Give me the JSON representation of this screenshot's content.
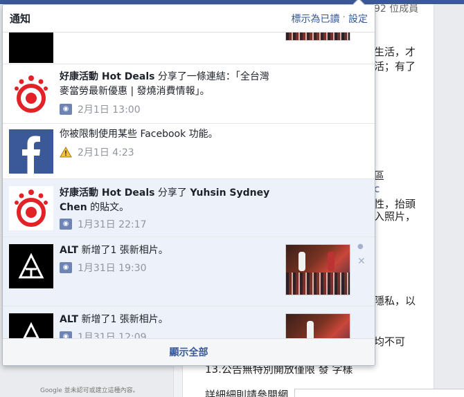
{
  "background": {
    "top_right_fragment": "92 位成員",
    "lines": [
      "生活，才",
      "活；有了",
      "區",
      "c",
      "性，抬頭",
      "入照片，",
      "隱私，以",
      "均不可",
      "13.公告無特別開放僅限 發 字樣",
      "詳細細則請參閱網"
    ],
    "left_footer": "Google 並未認可或建立這種內容。"
  },
  "panel": {
    "title": "通知",
    "mark_all_read": "標示為已讀",
    "separator": "·",
    "settings": "設定",
    "show_all": "顯示全部",
    "items": [
      {
        "actor": "好康活動 Hot Deals",
        "text": " 分享了一條連結：「全台灣麥當勞最新優惠 | 發燒消費情報」。",
        "time": "2月1日 13:00",
        "icon": "rss-icon",
        "unread": false
      },
      {
        "actor": "",
        "text": "你被限制使用某些 Facebook 功能。",
        "time": "2月1日 4:23",
        "icon": "warning-icon",
        "unread": false
      },
      {
        "actor": "好康活動 Hot Deals",
        "text": " 分享了 ",
        "target": "Yuhsin Sydney Chen",
        "text2": " 的貼文。",
        "time": "1月31日 22:17",
        "icon": "rss-icon",
        "unread": true
      },
      {
        "actor": "ALT",
        "text": " 新增了1 張新相片。",
        "time": "1月31日 19:30",
        "icon": "rss-icon",
        "unread": true
      },
      {
        "actor": "ALT",
        "text": " 新增了1 張新相片。",
        "time": "1月31日 12:09",
        "icon": "rss-icon",
        "unread": true
      }
    ]
  }
}
